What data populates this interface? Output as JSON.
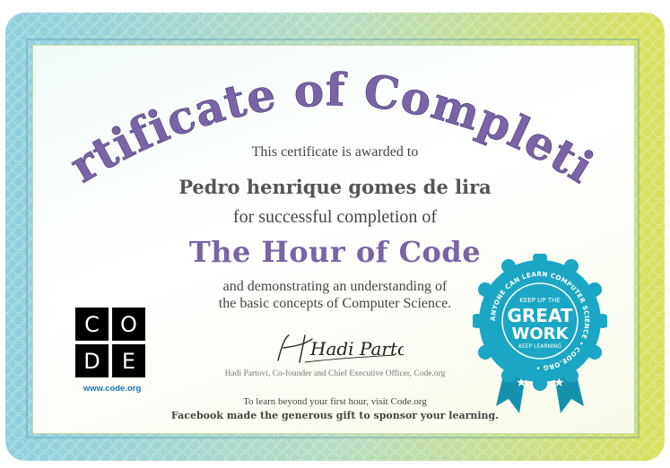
{
  "certificate": {
    "title": "Certificate of Completion",
    "awarded_text": "This certificate is awarded to",
    "recipient_name": "Pedro henrique gomes de lira",
    "completion_text": "for successful completion of",
    "course_name": "The Hour of Code",
    "demonstrating_line1": "and demonstrating an understanding of",
    "demonstrating_line2": "the basic concepts of Computer Science."
  },
  "logo": {
    "letters": [
      "C",
      "O",
      "D",
      "E"
    ],
    "url": "www.code.org"
  },
  "signature": {
    "handwriting": "Hadi Partovi",
    "caption": "Hadi Partovi, Co-founder and Chief Executive Officer, Code.org"
  },
  "footer": {
    "learn_more": "To learn beyond your first hour, visit Code.org",
    "sponsor": "Facebook made the generous gift to sponsor your learning."
  },
  "badge": {
    "ring_text": "ANYONE CAN LEARN COMPUTER SCIENCE • CODE.ORG •",
    "top_text": "KEEP UP THE",
    "main_line1": "GREAT",
    "main_line2": "WORK",
    "bottom_text": "KEEP LEARNING"
  },
  "colors": {
    "title_purple": "#7a63a6",
    "badge_teal": "#1aa6c4",
    "border_left": "#7fc3d6",
    "border_right": "#cfd84a"
  }
}
